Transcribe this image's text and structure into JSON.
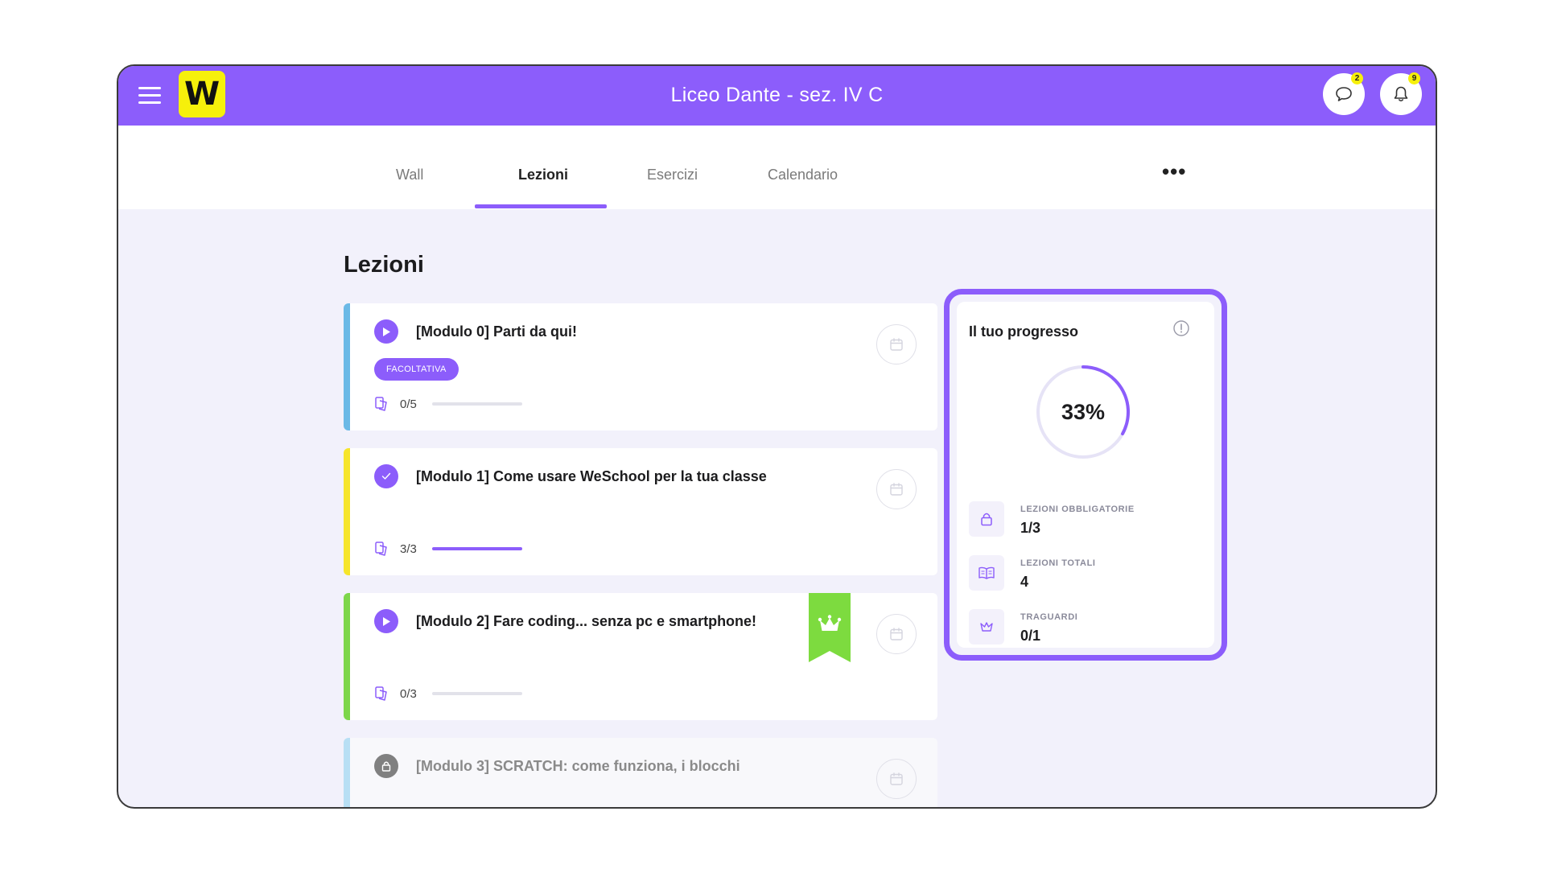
{
  "header": {
    "title": "Liceo Dante - sez. IV C",
    "logo_letter": "W",
    "chat_badge": "2",
    "notifications_badge": "9"
  },
  "tabs": [
    {
      "label": "Wall",
      "active": false
    },
    {
      "label": "Lezioni",
      "active": true
    },
    {
      "label": "Esercizi",
      "active": false
    },
    {
      "label": "Calendario",
      "active": false
    }
  ],
  "more_label": "•••",
  "page_title": "Lezioni",
  "lessons": [
    {
      "title": "[Modulo 0] Parti da qui!",
      "tag": "FACOLTATIVA",
      "progress": "0/5",
      "fraction": 0,
      "stripe_color": "#6bb9e6",
      "status": "play"
    },
    {
      "title": "[Modulo 1] Come usare WeSchool per la tua classe",
      "progress": "3/3",
      "fraction": 1,
      "stripe_color": "#f6e52b",
      "status": "done"
    },
    {
      "title": "[Modulo 2] Fare coding... senza pc e smartphone!",
      "progress": "0/3",
      "fraction": 0,
      "stripe_color": "#7dd64a",
      "status": "play",
      "ribbon_color": "#7ddb3f"
    },
    {
      "title": "[Modulo 3] SCRATCH: come funziona, i blocchi",
      "stripe_color": "#b8dff4",
      "status": "locked"
    }
  ],
  "progress_panel": {
    "title": "Il tuo progresso",
    "percent_label": "33%",
    "percent": 33,
    "stats": [
      {
        "label": "LEZIONI OBBLIGATORIE",
        "value": "1/3",
        "icon": "lock-icon"
      },
      {
        "label": "LEZIONI TOTALI",
        "value": "4",
        "icon": "book-icon"
      },
      {
        "label": "TRAGUARDI",
        "value": "0/1",
        "icon": "crown-icon"
      }
    ]
  },
  "colors": {
    "accent": "#8c5dfb",
    "logo_bg": "#f6f00b",
    "background": "#f2f1fb"
  }
}
